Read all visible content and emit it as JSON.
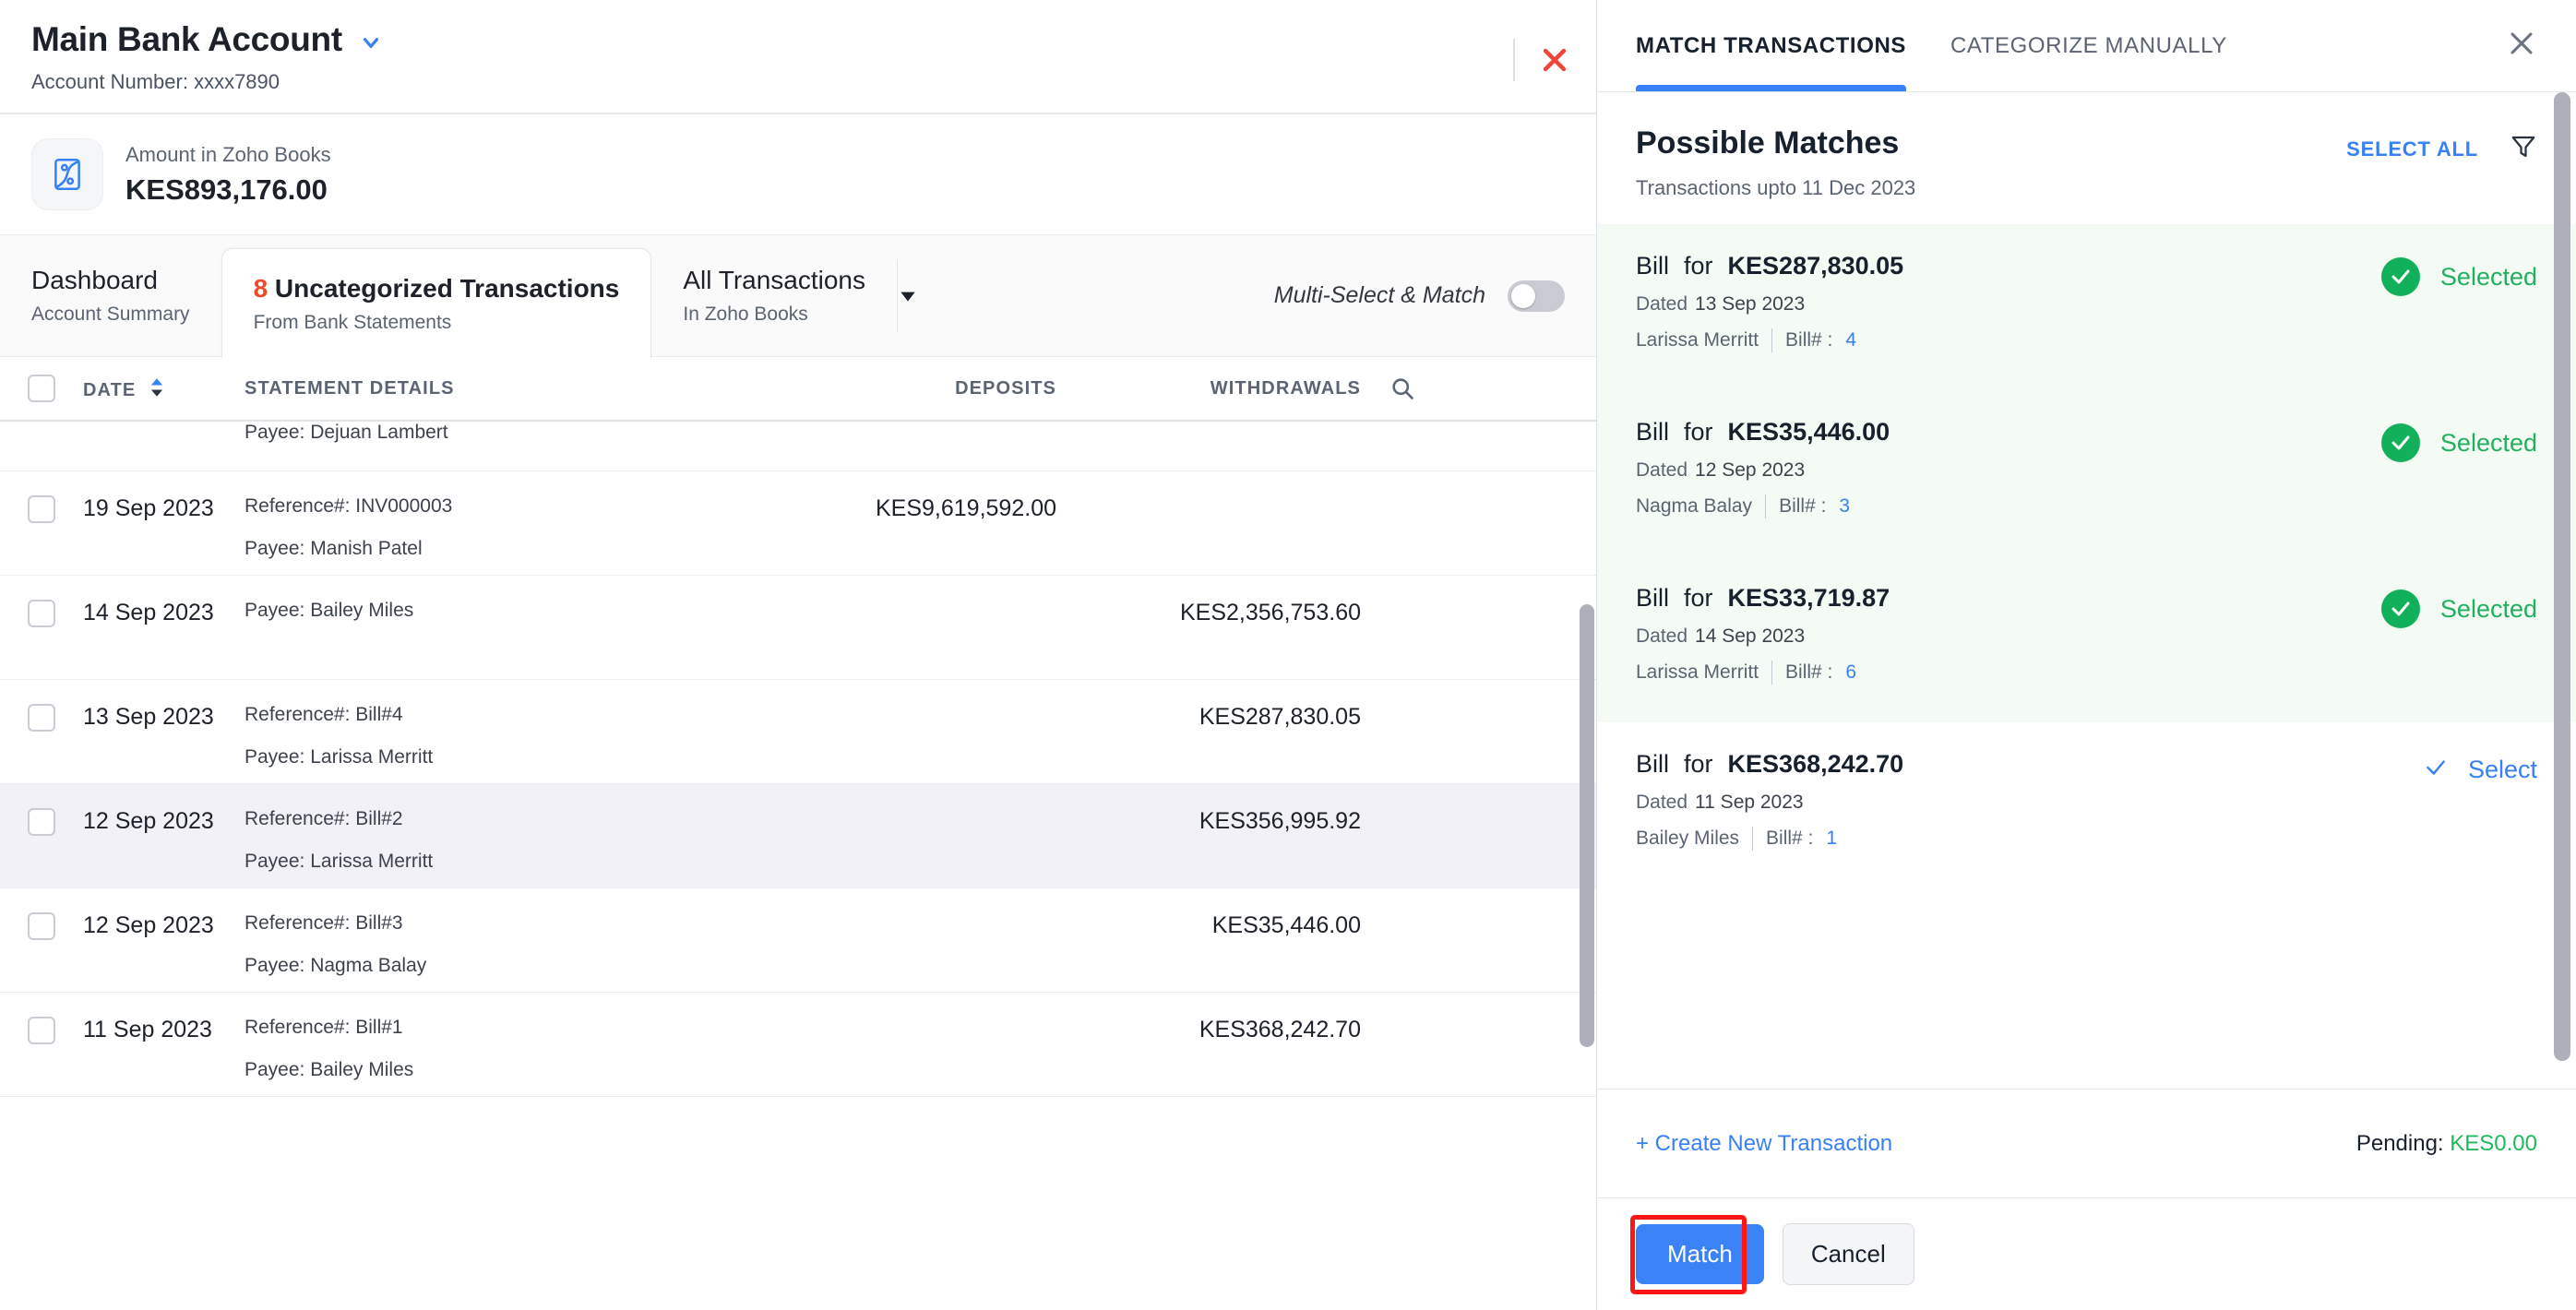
{
  "account": {
    "title": "Main Bank Account",
    "number_label": "Account Number: xxxx7890",
    "amount_label": "Amount in Zoho Books",
    "amount_value": "KES893,176.00",
    "close_icon": "close-red-x-icon",
    "dropdown_icon": "chevron-down-icon",
    "brand_icon": "zoho-books-icon"
  },
  "tabs": [
    {
      "main": "Dashboard",
      "sub": "Account Summary",
      "active": false
    },
    {
      "count": "8",
      "main": "Uncategorized Transactions",
      "sub": "From Bank Statements",
      "active": true
    },
    {
      "main": "All Transactions",
      "sub": "In Zoho Books",
      "active": false,
      "has_dropdown": true
    }
  ],
  "multi_select": {
    "label": "Multi-Select & Match",
    "enabled": false
  },
  "table": {
    "columns": [
      "DATE",
      "STATEMENT DETAILS",
      "DEPOSITS",
      "WITHDRAWALS"
    ],
    "search_icon": "search-icon",
    "sort_icon": "sort-arrows-icon",
    "partial_row": {
      "payee": "Payee: Dejuan Lambert"
    },
    "rows": [
      {
        "date": "19 Sep 2023",
        "reference": "Reference#: INV000003",
        "payee": "Payee: Manish Patel",
        "deposit": "KES9,619,592.00",
        "withdrawal": "",
        "selected": false
      },
      {
        "date": "14 Sep 2023",
        "reference": "",
        "payee": "Payee: Bailey Miles",
        "deposit": "",
        "withdrawal": "KES2,356,753.60",
        "selected": false
      },
      {
        "date": "13 Sep 2023",
        "reference": "Reference#: Bill#4",
        "payee": "Payee: Larissa Merritt",
        "deposit": "",
        "withdrawal": "KES287,830.05",
        "selected": false
      },
      {
        "date": "12 Sep 2023",
        "reference": "Reference#: Bill#2",
        "payee": "Payee: Larissa Merritt",
        "deposit": "",
        "withdrawal": "KES356,995.92",
        "selected": true
      },
      {
        "date": "12 Sep 2023",
        "reference": "Reference#: Bill#3",
        "payee": "Payee: Nagma Balay",
        "deposit": "",
        "withdrawal": "KES35,446.00",
        "selected": false
      },
      {
        "date": "11 Sep 2023",
        "reference": "Reference#: Bill#1",
        "payee": "Payee: Bailey Miles",
        "deposit": "",
        "withdrawal": "KES368,242.70",
        "selected": false
      }
    ]
  },
  "panel": {
    "tabs": [
      {
        "label": "MATCH TRANSACTIONS",
        "active": true
      },
      {
        "label": "CATEGORIZE MANUALLY",
        "active": false
      }
    ],
    "close_icon": "close-icon",
    "heading": "Possible Matches",
    "subheading": "Transactions upto 11 Dec 2023",
    "select_all": "SELECT ALL",
    "filter_icon": "filter-funnel-icon",
    "matches": [
      {
        "type": "Bill",
        "for_label": "for",
        "amount": "KES287,830.05",
        "dated_label": "Dated",
        "date": "13 Sep 2023",
        "party": "Larissa Merritt",
        "bill_label": "Bill# :",
        "bill_no": "4",
        "status": "Selected",
        "selected": true
      },
      {
        "type": "Bill",
        "for_label": "for",
        "amount": "KES35,446.00",
        "dated_label": "Dated",
        "date": "12 Sep 2023",
        "party": "Nagma Balay",
        "bill_label": "Bill# :",
        "bill_no": "3",
        "status": "Selected",
        "selected": true
      },
      {
        "type": "Bill",
        "for_label": "for",
        "amount": "KES33,719.87",
        "dated_label": "Dated",
        "date": "14 Sep 2023",
        "party": "Larissa Merritt",
        "bill_label": "Bill# :",
        "bill_no": "6",
        "status": "Selected",
        "selected": true
      },
      {
        "type": "Bill",
        "for_label": "for",
        "amount": "KES368,242.70",
        "dated_label": "Dated",
        "date": "11 Sep 2023",
        "party": "Bailey Miles",
        "bill_label": "Bill# :",
        "bill_no": "1",
        "status": "Select",
        "selected": false
      }
    ],
    "create_new": "+ Create New Transaction",
    "pending_label": "Pending:",
    "pending_amount": "KES0.00",
    "match_button": "Match",
    "cancel_button": "Cancel"
  },
  "colors": {
    "accent_blue": "#3780f5",
    "green": "#13b05c",
    "red": "#ef4b2a",
    "highlight_red": "#ff1515",
    "selected_row": "#f2f1f7",
    "match_selected_bg": "#f4fbf4"
  }
}
